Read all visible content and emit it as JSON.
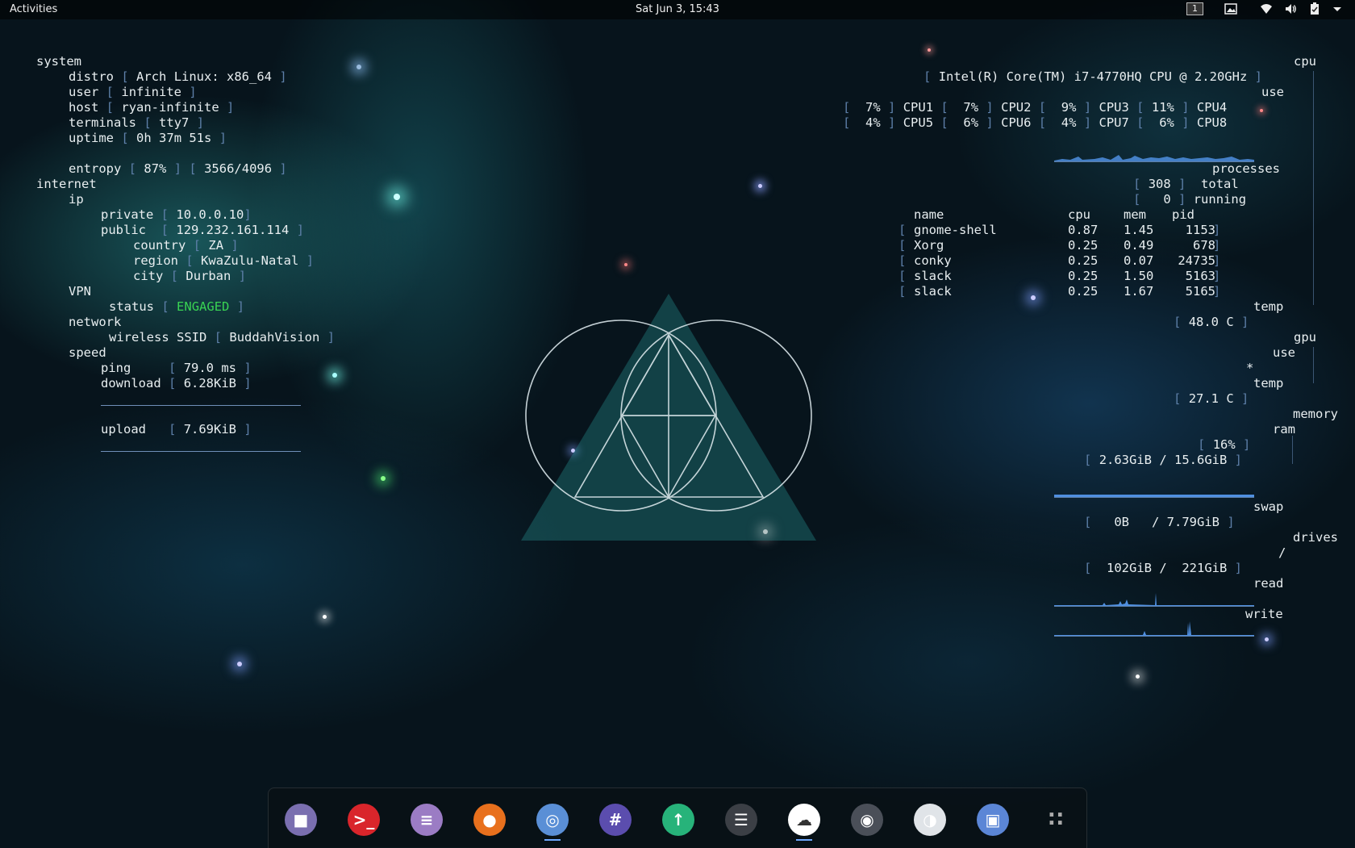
{
  "topbar": {
    "activities": "Activities",
    "clock": "Sat Jun  3, 15:43",
    "workspace": "1"
  },
  "left": {
    "system_header": "system",
    "distro_label": "distro",
    "distro_value": "Arch Linux: x86_64",
    "user_label": "user",
    "user_value": "infinite",
    "host_label": "host",
    "host_value": "ryan-infinite",
    "terminals_label": "terminals",
    "terminals_value": "tty7",
    "uptime_label": "uptime",
    "uptime_value": "0h 37m 51s",
    "entropy_label": "entropy",
    "entropy_pct": "87%",
    "entropy_value": "3566/4096",
    "internet_header": "internet",
    "ip_label": "ip",
    "private_label": "private",
    "private_value": "10.0.0.10",
    "public_label": "public",
    "public_value": "129.232.161.114",
    "country_label": "country",
    "country_value": "ZA",
    "region_label": "region",
    "region_value": "KwaZulu-Natal",
    "city_label": "city",
    "city_value": "Durban",
    "vpn_label": "VPN",
    "status_label": "status",
    "status_value": "ENGAGED",
    "network_label": "network",
    "ssid_label": "wireless SSID",
    "ssid_value": "BuddahVision",
    "speed_label": "speed",
    "ping_label": "ping",
    "ping_value": "79.0 ms",
    "download_label": "download",
    "download_value": "6.28KiB",
    "upload_label": "upload",
    "upload_value": "7.69KiB"
  },
  "right": {
    "cpu_header": "cpu",
    "cpu_model": "Intel(R) Core(TM) i7-4770HQ CPU @ 2.20GHz",
    "use_label": "use",
    "cpus": [
      {
        "pct": " 7%",
        "name": "CPU1"
      },
      {
        "pct": " 7%",
        "name": "CPU2"
      },
      {
        "pct": " 9%",
        "name": "CPU3"
      },
      {
        "pct": "11%",
        "name": "CPU4"
      },
      {
        "pct": " 4%",
        "name": "CPU5"
      },
      {
        "pct": " 6%",
        "name": "CPU6"
      },
      {
        "pct": " 4%",
        "name": "CPU7"
      },
      {
        "pct": " 6%",
        "name": "CPU8"
      }
    ],
    "processes_header": "processes",
    "proc_total_value": "308",
    "proc_total_label": "total",
    "proc_running_value": "0",
    "proc_running_label": "running",
    "table_headers": {
      "name": "name",
      "cpu": "cpu",
      "mem": "mem",
      "pid": "pid"
    },
    "procs": [
      {
        "name": "gnome-shell",
        "cpu": "0.87",
        "mem": "1.45",
        "pid": "1153"
      },
      {
        "name": "Xorg",
        "cpu": "0.25",
        "mem": "0.49",
        "pid": "678"
      },
      {
        "name": "conky",
        "cpu": "0.25",
        "mem": "0.07",
        "pid": "24735"
      },
      {
        "name": "slack",
        "cpu": "0.25",
        "mem": "1.50",
        "pid": "5163"
      },
      {
        "name": "slack",
        "cpu": "0.25",
        "mem": "1.67",
        "pid": "5165"
      }
    ],
    "temp_label": "temp",
    "cpu_temp": "48.0 C",
    "gpu_header": "gpu",
    "gpu_use_label": "use",
    "gpu_use_value": "*",
    "gpu_temp_label": "temp",
    "gpu_temp": "27.1 C",
    "memory_header": "memory",
    "ram_label": "ram",
    "ram_pct": "16%",
    "ram_value": "2.63GiB / 15.6GiB",
    "swap_label": "swap",
    "swap_value": "  0B   / 7.79GiB",
    "drives_header": "drives",
    "root_label": "/",
    "root_value": "102GiB /  221GiB",
    "read_label": "read",
    "write_label": "write"
  },
  "dock": {
    "apps": [
      {
        "icon": "files-icon",
        "color": "#7a6fb0"
      },
      {
        "icon": "terminal-icon",
        "color": "#d9252b"
      },
      {
        "icon": "text-editor-icon",
        "color": "#9b7cc4"
      },
      {
        "icon": "firefox-icon",
        "color": "#e8701d"
      },
      {
        "icon": "chrome-icon",
        "color": "#5a8fd6"
      },
      {
        "icon": "slack-icon",
        "color": "#5b4dae"
      },
      {
        "icon": "git-icon",
        "color": "#27b37a"
      },
      {
        "icon": "database-icon",
        "color": "#3b3f45"
      },
      {
        "icon": "cloud-icon",
        "color": "#ffffff"
      },
      {
        "icon": "camera-icon",
        "color": "#4a4f58"
      },
      {
        "icon": "tweaks-icon",
        "color": "#e0e4e8"
      },
      {
        "icon": "remote-desktop-icon",
        "color": "#5b86d6"
      },
      {
        "icon": "app-grid-icon",
        "color": "transparent"
      }
    ]
  },
  "colors": {
    "bracket": "#5d7fa8",
    "engaged": "#39d353",
    "graph": "#4f8fe0"
  }
}
